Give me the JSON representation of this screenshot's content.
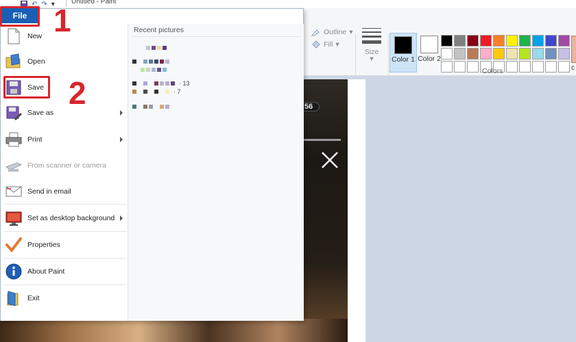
{
  "window": {
    "title": "Untitled - Paint"
  },
  "ribbon": {
    "outline_label": "Outline",
    "fill_label": "Fill",
    "size_label": "Size",
    "color1_label": "Color 1",
    "color2_label": "Color 2",
    "colors_group_label": "Colors",
    "edit_colors_label": "c",
    "color1_value": "#000000",
    "color2_value": "#ffffff",
    "palette": [
      "#000000",
      "#7f7f7f",
      "#880015",
      "#ed1c24",
      "#ff7f27",
      "#fff200",
      "#22b14c",
      "#00a2e8",
      "#3f48cc",
      "#a349a4",
      "#ffffff",
      "#c3c3c3",
      "#b97a57",
      "#ffaec9",
      "#ffc90e",
      "#efe4b0",
      "#b5e61d",
      "#99d9ea",
      "#7092be",
      "#c8bfe7",
      "#ffffff",
      "#ffffff",
      "#ffffff",
      "#ffffff",
      "#ffffff",
      "#ffffff",
      "#ffffff",
      "#ffffff",
      "#ffffff",
      "#ffffff"
    ]
  },
  "file_menu": {
    "tab_label": "File",
    "recent_title": "Recent pictures",
    "items": [
      {
        "label": "New",
        "icon": "new-file-icon"
      },
      {
        "label": "Open",
        "icon": "open-folder-icon"
      },
      {
        "label": "Save",
        "icon": "save-disk-icon"
      },
      {
        "label": "Save as",
        "icon": "save-as-icon"
      },
      {
        "label": "Print",
        "icon": "printer-icon"
      },
      {
        "label": "From scanner or camera",
        "icon": "scanner-icon"
      },
      {
        "label": "Send in email",
        "icon": "email-icon"
      },
      {
        "label": "Set as desktop background",
        "icon": "desktop-icon"
      },
      {
        "label": "Properties",
        "icon": "check-icon"
      },
      {
        "label": "About Paint",
        "icon": "info-icon"
      },
      {
        "label": "Exit",
        "icon": "exit-icon"
      }
    ],
    "recent_items": [
      {
        "num": ""
      },
      {
        "num": ""
      },
      {
        "num": ""
      },
      {
        "num": "· 13"
      },
      {
        "num": "· 7"
      },
      {
        "num": ""
      }
    ]
  },
  "annotations": {
    "step1": "1",
    "step2": "2"
  },
  "canvas": {
    "badge_text": "56"
  }
}
